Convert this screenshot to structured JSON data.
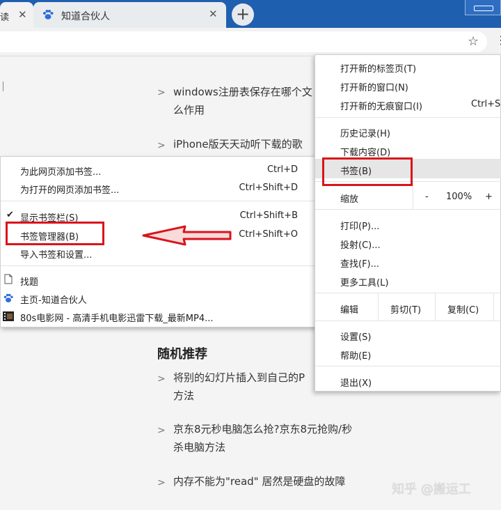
{
  "tabs": [
    {
      "title": "读",
      "close": "✕"
    },
    {
      "title": "知道合伙人",
      "close": "✕",
      "icon": "paw-icon"
    }
  ],
  "new_tab_label": "+",
  "toolbar": {
    "star": "☆"
  },
  "content": {
    "items_top": [
      {
        "line1": "windows注册表保存在哪个文",
        "line2": "么作用"
      },
      {
        "line1": "iPhone版天天动听下载的歌"
      }
    ],
    "section_title": "随机推荐",
    "items_bottom": [
      {
        "line1": "将别的幻灯片插入到自己的P",
        "line2": "方法"
      },
      {
        "line1": "京东8元秒电脑怎么抢?京东8元抢购/秒",
        "line2": "杀电脑方法"
      },
      {
        "line1": "内存不能为\"read\" 居然是硬盘的故障"
      }
    ],
    "watermark": "知乎 @搬运工"
  },
  "bookmark_menu": {
    "add_page": {
      "label": "为此网页添加书签...",
      "shortcut": "Ctrl+D"
    },
    "add_open_pages": {
      "label": "为打开的网页添加书签...",
      "shortcut": "Ctrl+Shift+D"
    },
    "show_bar": {
      "label": "显示书签栏(S)",
      "shortcut": "Ctrl+Shift+B",
      "check": "✔"
    },
    "manager": {
      "label": "书签管理器(B)",
      "shortcut": "Ctrl+Shift+O"
    },
    "import": {
      "label": "导入书签和设置..."
    },
    "bookmarks": [
      {
        "label": "找题",
        "icon": "page-icon"
      },
      {
        "label": "主页-知道合伙人",
        "icon": "paw-icon"
      },
      {
        "label": "80s电影网 - 高清手机电影迅雷下载_最新MP4...",
        "icon": "film-icon"
      }
    ]
  },
  "main_menu": {
    "new_tab": {
      "label": "打开新的标签页(T)"
    },
    "new_window": {
      "label": "打开新的窗口(N)"
    },
    "new_incognito": {
      "label": "打开新的无痕窗口(I)",
      "shortcut": "Ctrl+S"
    },
    "history": {
      "label": "历史记录(H)"
    },
    "downloads": {
      "label": "下载内容(D)"
    },
    "bookmarks": {
      "label": "书签(B)"
    },
    "zoom": {
      "label": "缩放",
      "minus": "-",
      "value": "100%",
      "plus": "+"
    },
    "print": {
      "label": "打印(P)..."
    },
    "cast": {
      "label": "投射(C)..."
    },
    "find": {
      "label": "查找(F)..."
    },
    "more_tools": {
      "label": "更多工具(L)"
    },
    "edit": {
      "label": "编辑",
      "cut": "剪切(T)",
      "copy": "复制(C)"
    },
    "settings": {
      "label": "设置(S)"
    },
    "help": {
      "label": "帮助(E)"
    },
    "exit": {
      "label": "退出(X)"
    }
  },
  "colors": {
    "titlebar": "#1f5fb0",
    "annotation_red": "#d9141b",
    "menu_highlight": "#e6e6e6"
  }
}
